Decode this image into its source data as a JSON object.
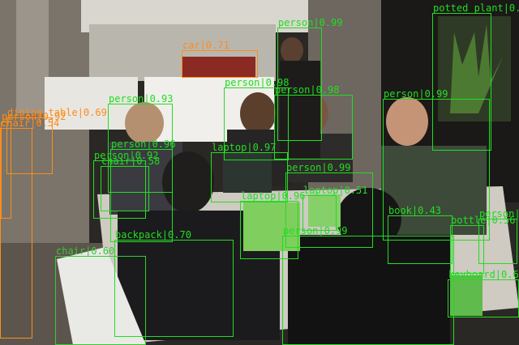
{
  "image": {
    "description_icon": "photo-icon",
    "scene": "office-cafe-meeting"
  },
  "colors": {
    "box_default": "#22dd22",
    "box_furniture": "#33cc33",
    "box_orange": "#ff8c1a"
  },
  "detections": [
    {
      "label": "potted_plant",
      "score": "0.79",
      "text": "potted_plant|0.79"
    },
    {
      "label": "person",
      "score": "0.99",
      "text": "person|0.99"
    },
    {
      "label": "car",
      "score": "0.71",
      "text": "car|0.71"
    },
    {
      "label": "person",
      "score": "0.98",
      "text": "person|0.98"
    },
    {
      "label": "person",
      "score": "0.98",
      "text": "person|0.98"
    },
    {
      "label": "person",
      "score": "0.99",
      "text": "person|0.99"
    },
    {
      "label": "person",
      "score": "0.93",
      "text": "person|0.93"
    },
    {
      "label": "dining_table",
      "score": "0.69",
      "text": "dining_table|0.69"
    },
    {
      "label": "chair",
      "score": "0.54",
      "text": "chair|0.54"
    },
    {
      "label": "person",
      "score": "0.96",
      "text": "person|0.96"
    },
    {
      "label": "laptop",
      "score": "0.97",
      "text": "laptop|0.97"
    },
    {
      "label": "person",
      "score": "0.92",
      "text": "person|0.92"
    },
    {
      "label": "chair",
      "score": "0.58",
      "text": "chair|0.58"
    },
    {
      "label": "person",
      "score": "0.99",
      "text": "person|0.99"
    },
    {
      "label": "laptop",
      "score": "0.51",
      "text": "laptop|0.51"
    },
    {
      "label": "laptop",
      "score": "0.96",
      "text": "laptop|0.96"
    },
    {
      "label": "book",
      "score": "0.43",
      "text": "book|0.43"
    },
    {
      "label": "bottle",
      "score": "0.56",
      "text": "bottle|0.56"
    },
    {
      "label": "backpack",
      "score": "0.70",
      "text": "backpack|0.70"
    },
    {
      "label": "chair",
      "score": "0.60",
      "text": "chair|0.60"
    },
    {
      "label": "keyboard",
      "score": "0.61",
      "text": "keyboard|0.61"
    },
    {
      "label": "person",
      "score": "0.99",
      "text": "person|0.99"
    },
    {
      "label": "person",
      "score": "0.99",
      "text": "person|0.99"
    },
    {
      "label": "person",
      "score": "0.92",
      "text": "person|0.92"
    }
  ]
}
